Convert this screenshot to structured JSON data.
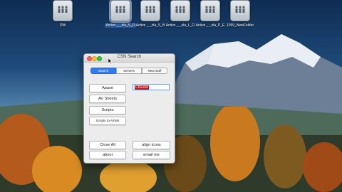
{
  "desktop": {
    "icons": [
      {
        "label": "DW",
        "selected": false
      },
      {
        "label": "Active _ _zla_S_D",
        "selected": true
      },
      {
        "label": "Active _ _zla_S_B",
        "selected": false
      },
      {
        "label": "Active _ _zla_L_O",
        "selected": false
      },
      {
        "label": "Active _ _zla_P_E",
        "selected": false
      },
      {
        "label": "1099_NewFolder",
        "selected": false
      }
    ]
  },
  "window": {
    "title": "CSN Search",
    "tabs": [
      {
        "label": "Search",
        "active": true
      },
      {
        "label": "Servers",
        "active": false
      },
      {
        "label": "New stuff",
        "active": false
      }
    ],
    "buttons": {
      "apace": "Apace",
      "av_sheets": "AV Sheets",
      "scripts": "Scripts",
      "scripts_to_artists": "Scripts to Artists",
      "close_all": "Close All",
      "align_icons": "align icons",
      "about": "about",
      "email_me": "email me"
    },
    "search_field": {
      "value": "CREAM"
    }
  },
  "colors": {
    "accent": "#2f7bf5",
    "field_highlight": "#c11b1b"
  }
}
